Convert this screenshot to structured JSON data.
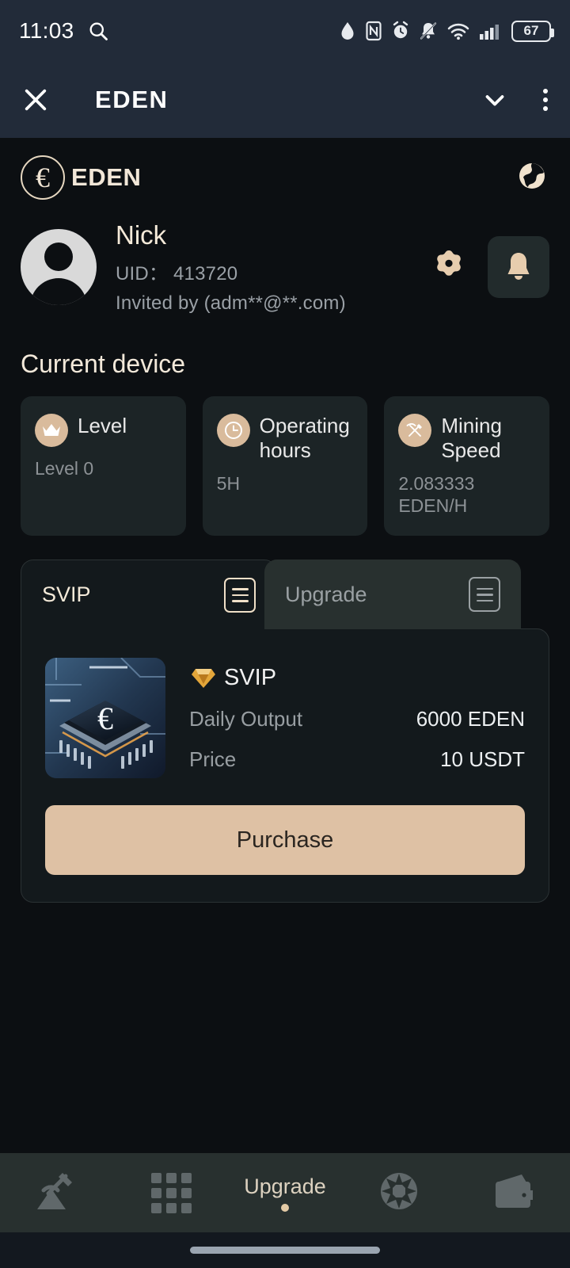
{
  "status_bar": {
    "time": "11:03",
    "battery_level": "67",
    "icons": [
      "search-icon",
      "water-drop-icon",
      "nfc-icon",
      "alarm-clock-icon",
      "bell-muted-icon",
      "wifi-icon",
      "cellular-signal-icon",
      "battery-icon"
    ]
  },
  "app_bar": {
    "close_label": "close-icon",
    "title": "EDEN",
    "chevron_label": "chevron-down-icon",
    "overflow_label": "more-options-icon"
  },
  "brand": {
    "mark_glyph": "€",
    "name": "EDEN",
    "globe_label": "language-globe-icon"
  },
  "profile": {
    "name": "Nick",
    "uid_line": "UID：  413720",
    "invited_line": "Invited by (adm**@**.com)",
    "settings_label": "settings-gear-icon",
    "notifications_label": "notification-bell-icon"
  },
  "current_device": {
    "title": "Current device",
    "cards": [
      {
        "icon": "crown-icon",
        "label": "Level",
        "value": "Level 0"
      },
      {
        "icon": "clock-icon",
        "label": "Operating hours",
        "value": "5H"
      },
      {
        "icon": "pickaxe-icon",
        "label": "Mining Speed",
        "value": "2.083333 EDEN/H"
      }
    ]
  },
  "tabs": {
    "items": [
      {
        "label": "SVIP",
        "icon": "list-icon",
        "active": true
      },
      {
        "label": "Upgrade",
        "icon": "list-icon",
        "active": false
      }
    ]
  },
  "product": {
    "image_label": "cpu-chip-image",
    "badge_label": "svip-diamond-icon",
    "name": "SVIP",
    "rows": [
      {
        "key": "Daily Output",
        "value": "6000 EDEN"
      },
      {
        "key": "Price",
        "value": "10 USDT"
      }
    ],
    "purchase_label": "Purchase"
  },
  "bottom_nav": {
    "items": [
      {
        "icon": "mining-pickaxe-icon",
        "label": "",
        "active": false
      },
      {
        "icon": "grid-apps-icon",
        "label": "",
        "active": false
      },
      {
        "icon": "",
        "label": "Upgrade",
        "active": true
      },
      {
        "icon": "fan-turbine-icon",
        "label": "",
        "active": false
      },
      {
        "icon": "wallet-icon",
        "label": "",
        "active": false
      }
    ]
  },
  "colors": {
    "accent": "#dec1a4",
    "cream": "#f2e7d8",
    "panel": "#13191c",
    "card": "#1c2426",
    "chrome": "#222b39",
    "nav": "#28302f"
  }
}
